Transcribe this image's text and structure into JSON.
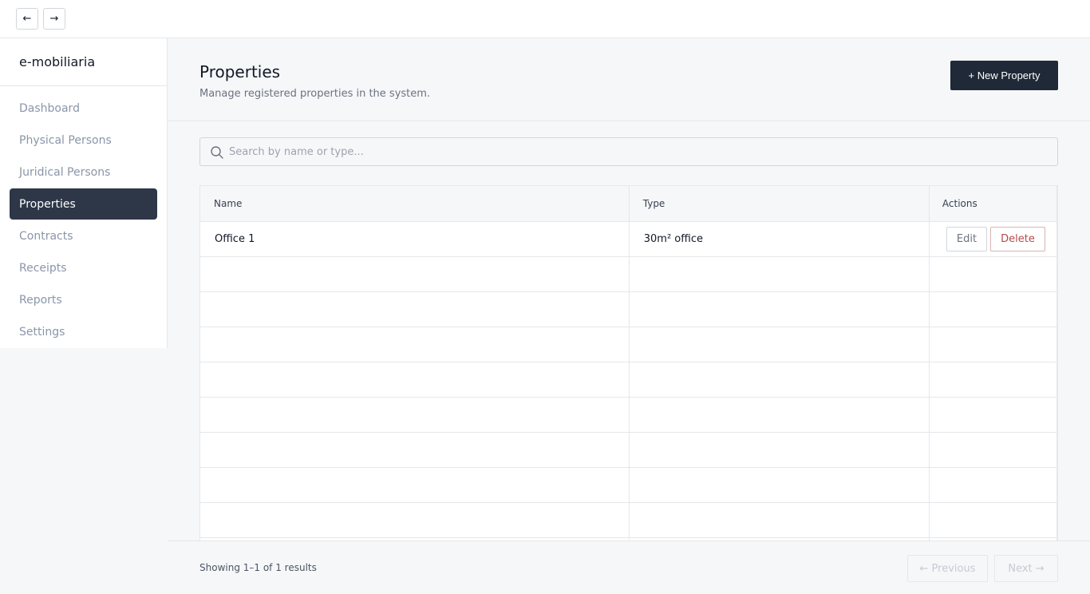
{
  "nav": {
    "back": "←",
    "forward": "→"
  },
  "sidebar": {
    "brand": "e-mobiliaria",
    "items": [
      {
        "label": "Dashboard",
        "active": false
      },
      {
        "label": "Physical Persons",
        "active": false
      },
      {
        "label": "Juridical Persons",
        "active": false
      },
      {
        "label": "Properties",
        "active": true
      },
      {
        "label": "Contracts",
        "active": false
      },
      {
        "label": "Receipts",
        "active": false
      },
      {
        "label": "Reports",
        "active": false
      },
      {
        "label": "Settings",
        "active": false
      }
    ]
  },
  "header": {
    "title": "Properties",
    "subtitle": "Manage registered properties in the system.",
    "new_button": "+ New Property"
  },
  "search": {
    "placeholder": "Search by name or type...",
    "value": ""
  },
  "table": {
    "columns": [
      "Name",
      "Type",
      "Actions"
    ],
    "rows": [
      {
        "name": "Office 1",
        "type": "30m² office",
        "edit": "Edit",
        "delete": "Delete"
      }
    ]
  },
  "footer": {
    "results": "Showing 1–1 of 1 results",
    "previous": "← Previous",
    "next": "Next →"
  },
  "colors": {
    "primary": "#1f2937",
    "sidebar_active": "#2d3748",
    "danger": "#b44b4b"
  }
}
